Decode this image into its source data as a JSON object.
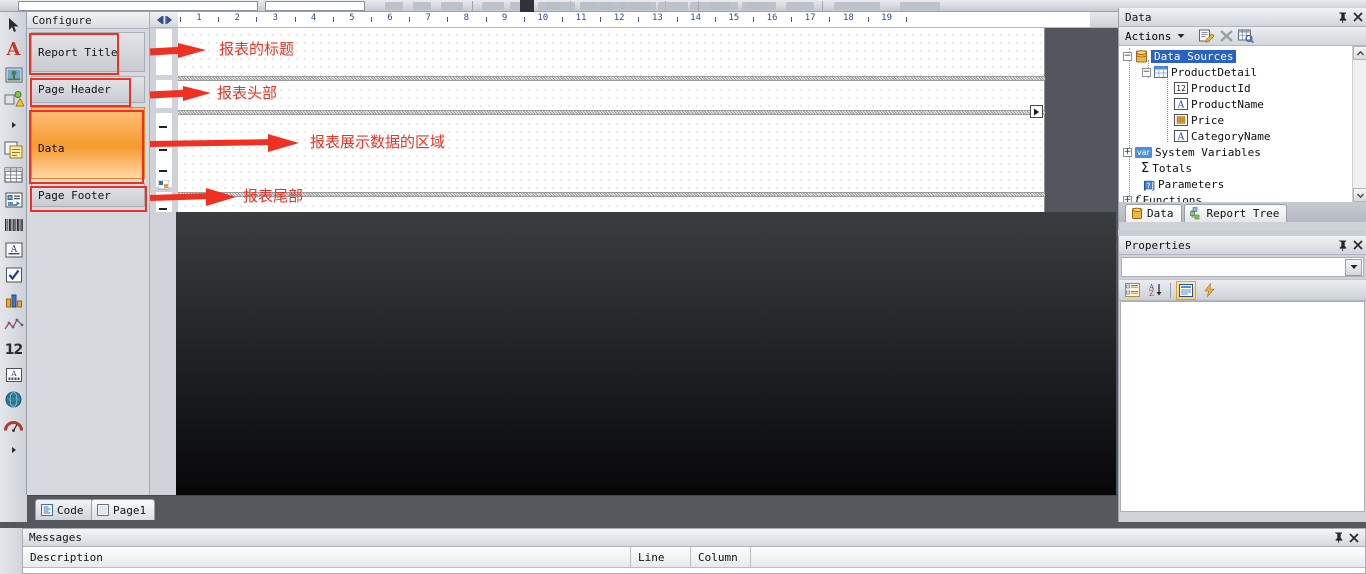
{
  "toolbox": {
    "items": [
      {
        "name": "pointer-tool",
        "icon": "pointer-icon"
      },
      {
        "name": "text-tool",
        "icon": "text-a-icon"
      },
      {
        "name": "image-tool",
        "icon": "image-icon"
      },
      {
        "name": "shape-tool",
        "icon": "shape-icon"
      },
      {
        "name": "more-tools",
        "icon": "chevron-right-icon"
      },
      {
        "name": "panel-tool",
        "icon": "panel-icon"
      },
      {
        "name": "table-tool",
        "icon": "table-icon"
      },
      {
        "name": "form-tool",
        "icon": "form-icon"
      },
      {
        "name": "barcode-tool",
        "icon": "barcode-icon"
      },
      {
        "name": "richtext-tool",
        "icon": "richtext-icon"
      },
      {
        "name": "checkbox-tool",
        "icon": "checkbox-icon"
      },
      {
        "name": "chart-tool",
        "icon": "chart-icon"
      },
      {
        "name": "sparkline-tool",
        "icon": "sparkline-icon"
      },
      {
        "name": "number-tool",
        "icon": "number-12-icon"
      },
      {
        "name": "zipcode-tool",
        "icon": "zipcode-icon"
      },
      {
        "name": "map-tool",
        "icon": "globe-icon"
      },
      {
        "name": "gauge-tool",
        "icon": "gauge-icon"
      },
      {
        "name": "more-tools-2",
        "icon": "chevron-right-icon"
      }
    ]
  },
  "configure": {
    "title": "Configure",
    "nav_prev": "prev-arrow-icon",
    "nav_next": "next-arrow-icon",
    "bands": [
      {
        "label": "Report Title"
      },
      {
        "label": "Page Header"
      },
      {
        "label": "Data"
      },
      {
        "label": "Page Footer"
      }
    ]
  },
  "ruler": {
    "unit_numbers": [
      1,
      2,
      3,
      4,
      5,
      6,
      7,
      8,
      9,
      10,
      11,
      12,
      13,
      14,
      15,
      16,
      17,
      18,
      19
    ]
  },
  "annotations": [
    {
      "text": "报表的标题",
      "meaning": "report-title-annotation"
    },
    {
      "text": "报表头部",
      "meaning": "page-header-annotation"
    },
    {
      "text": "报表展示数据的区域",
      "meaning": "data-band-annotation"
    },
    {
      "text": "报表尾部",
      "meaning": "page-footer-annotation"
    }
  ],
  "page_tabs": [
    {
      "label": "Code",
      "icon": "code-icon",
      "active": true
    },
    {
      "label": "Page1",
      "icon": "page-icon",
      "active": false
    }
  ],
  "data_panel": {
    "title": "Data",
    "pin": "pin-icon",
    "close": "close-icon",
    "actions_label": "Actions",
    "action_icons": [
      "edit-icon",
      "delete-icon",
      "view-data-icon"
    ],
    "tree": [
      {
        "label": "Data Sources",
        "depth": 0,
        "expander": "minus",
        "icon": "datasource-icon",
        "selected": true
      },
      {
        "label": "ProductDetail",
        "depth": 1,
        "expander": "minus",
        "icon": "table-icon",
        "selected": false
      },
      {
        "label": "ProductId",
        "depth": 2,
        "expander": "none",
        "icon": "int-12-icon",
        "selected": false
      },
      {
        "label": "ProductName",
        "depth": 2,
        "expander": "none",
        "icon": "string-a-icon",
        "selected": false
      },
      {
        "label": "Price",
        "depth": 2,
        "expander": "none",
        "icon": "money-icon",
        "selected": false
      },
      {
        "label": "CategoryName",
        "depth": 2,
        "expander": "none",
        "icon": "string-a-icon",
        "selected": false
      },
      {
        "label": "System Variables",
        "depth": 0,
        "expander": "plus",
        "icon": "var-icon",
        "selected": false
      },
      {
        "label": "Totals",
        "depth": 0,
        "expander": "none",
        "icon": "sigma-icon",
        "selected": false
      },
      {
        "label": "Parameters",
        "depth": 0,
        "expander": "none",
        "icon": "parameter-icon",
        "selected": false
      },
      {
        "label": "Functions",
        "depth": 0,
        "expander": "plus",
        "icon": "function-icon",
        "selected": false
      }
    ],
    "tabs": [
      {
        "label": "Data",
        "icon": "database-icon",
        "active": true
      },
      {
        "label": "Report Tree",
        "icon": "tree-icon",
        "active": false
      }
    ]
  },
  "properties_panel": {
    "title": "Properties",
    "pin": "pin-icon",
    "close": "close-icon",
    "selected_object": "",
    "dropdown_icon": "chevron-down-icon",
    "toolbar": [
      {
        "name": "categorized-button",
        "icon": "categorized-icon",
        "active": false
      },
      {
        "name": "alphabetical-button",
        "icon": "sort-az-icon",
        "active": false
      },
      {
        "name": "property-pages-button",
        "icon": "property-pages-icon",
        "active": true
      },
      {
        "name": "events-button",
        "icon": "lightning-icon",
        "active": false
      }
    ]
  },
  "messages_panel": {
    "title": "Messages",
    "pin": "pin-icon",
    "close": "close-icon",
    "columns": [
      "Description",
      "Line",
      "Column"
    ],
    "rows": []
  },
  "colors": {
    "accent_red": "#ef3124",
    "data_band_orange": "#f59a2e",
    "selection_blue": "#2a61c4",
    "ruler_number_blue": "#2b4d96"
  }
}
